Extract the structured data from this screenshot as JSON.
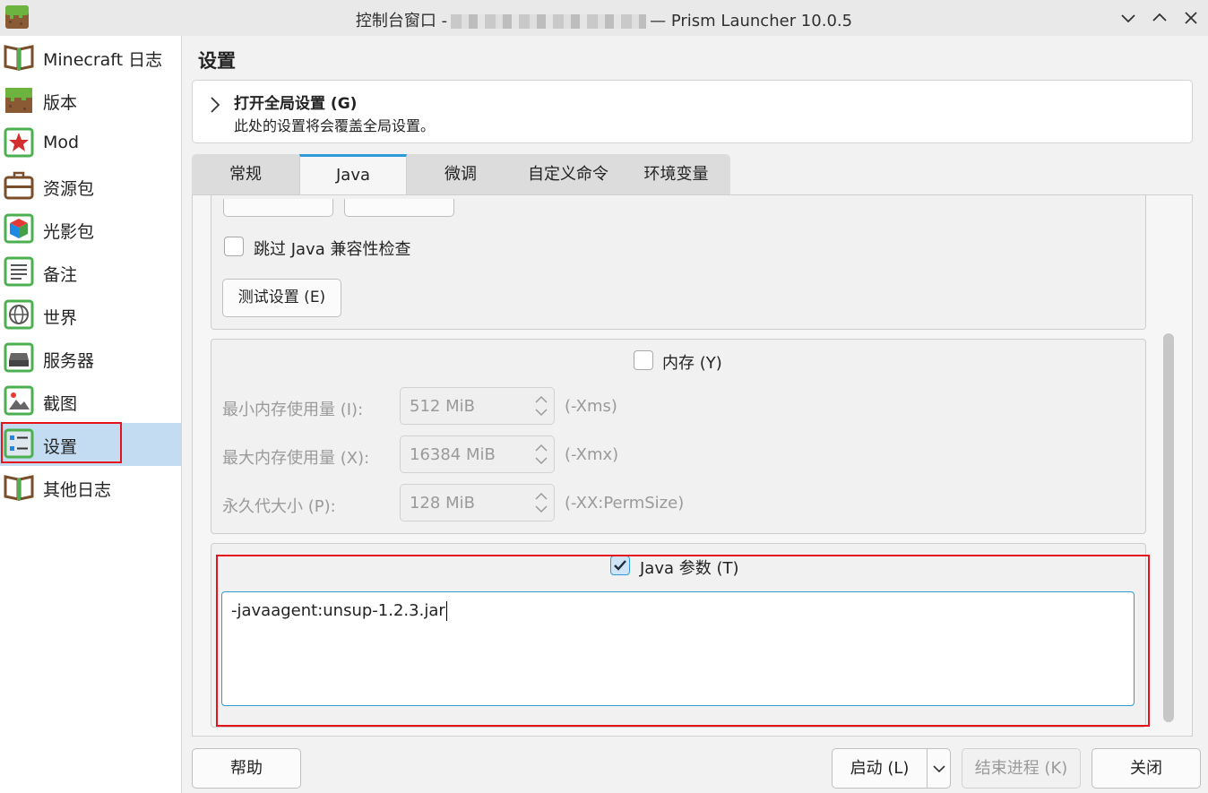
{
  "window": {
    "title_prefix": "控制台窗口 -",
    "title_suffix": "— Prism Launcher 10.0.5"
  },
  "sidebar": {
    "items": [
      {
        "label": "Minecraft 日志",
        "icon": "book-icon"
      },
      {
        "label": "版本",
        "icon": "grass-block-icon"
      },
      {
        "label": "Mod",
        "icon": "star-icon"
      },
      {
        "label": "资源包",
        "icon": "briefcase-icon"
      },
      {
        "label": "光影包",
        "icon": "cube-icon"
      },
      {
        "label": "备注",
        "icon": "notes-icon"
      },
      {
        "label": "世界",
        "icon": "globe-icon"
      },
      {
        "label": "服务器",
        "icon": "server-icon"
      },
      {
        "label": "截图",
        "icon": "image-icon"
      },
      {
        "label": "设置",
        "icon": "settings-icon"
      },
      {
        "label": "其他日志",
        "icon": "book-icon"
      }
    ],
    "active_index": 9
  },
  "page": {
    "title": "设置",
    "global": {
      "title": "打开全局设置 (G)",
      "subtitle": "此处的设置将会覆盖全局设置。"
    },
    "tabs": [
      "常规",
      "Java",
      "微调",
      "自定义命令",
      "环境变量"
    ],
    "active_tab": 1
  },
  "java": {
    "skip_check_label": "跳过 Java 兼容性检查",
    "test_button": "测试设置 (E)",
    "memory": {
      "title": "内存 (Y)",
      "checked": false,
      "rows": [
        {
          "label": "最小内存使用量 (I):",
          "value": "512 MiB",
          "suffix": "(-Xms)"
        },
        {
          "label": "最大内存使用量 (X):",
          "value": "16384 MiB",
          "suffix": "(-Xmx)"
        },
        {
          "label": "永久代大小 (P):",
          "value": "128 MiB",
          "suffix": "(-XX:PermSize)"
        }
      ]
    },
    "args": {
      "title": "Java 参数 (T)",
      "checked": true,
      "value": "-javaagent:unsup-1.2.3.jar"
    }
  },
  "bottom": {
    "help": "帮助",
    "launch": "启动 (L)",
    "kill": "结束进程 (K)",
    "close": "关闭"
  },
  "colors": {
    "accent": "#2e9bd8",
    "highlight": "#e5131b",
    "selection": "#c3dcf1"
  }
}
